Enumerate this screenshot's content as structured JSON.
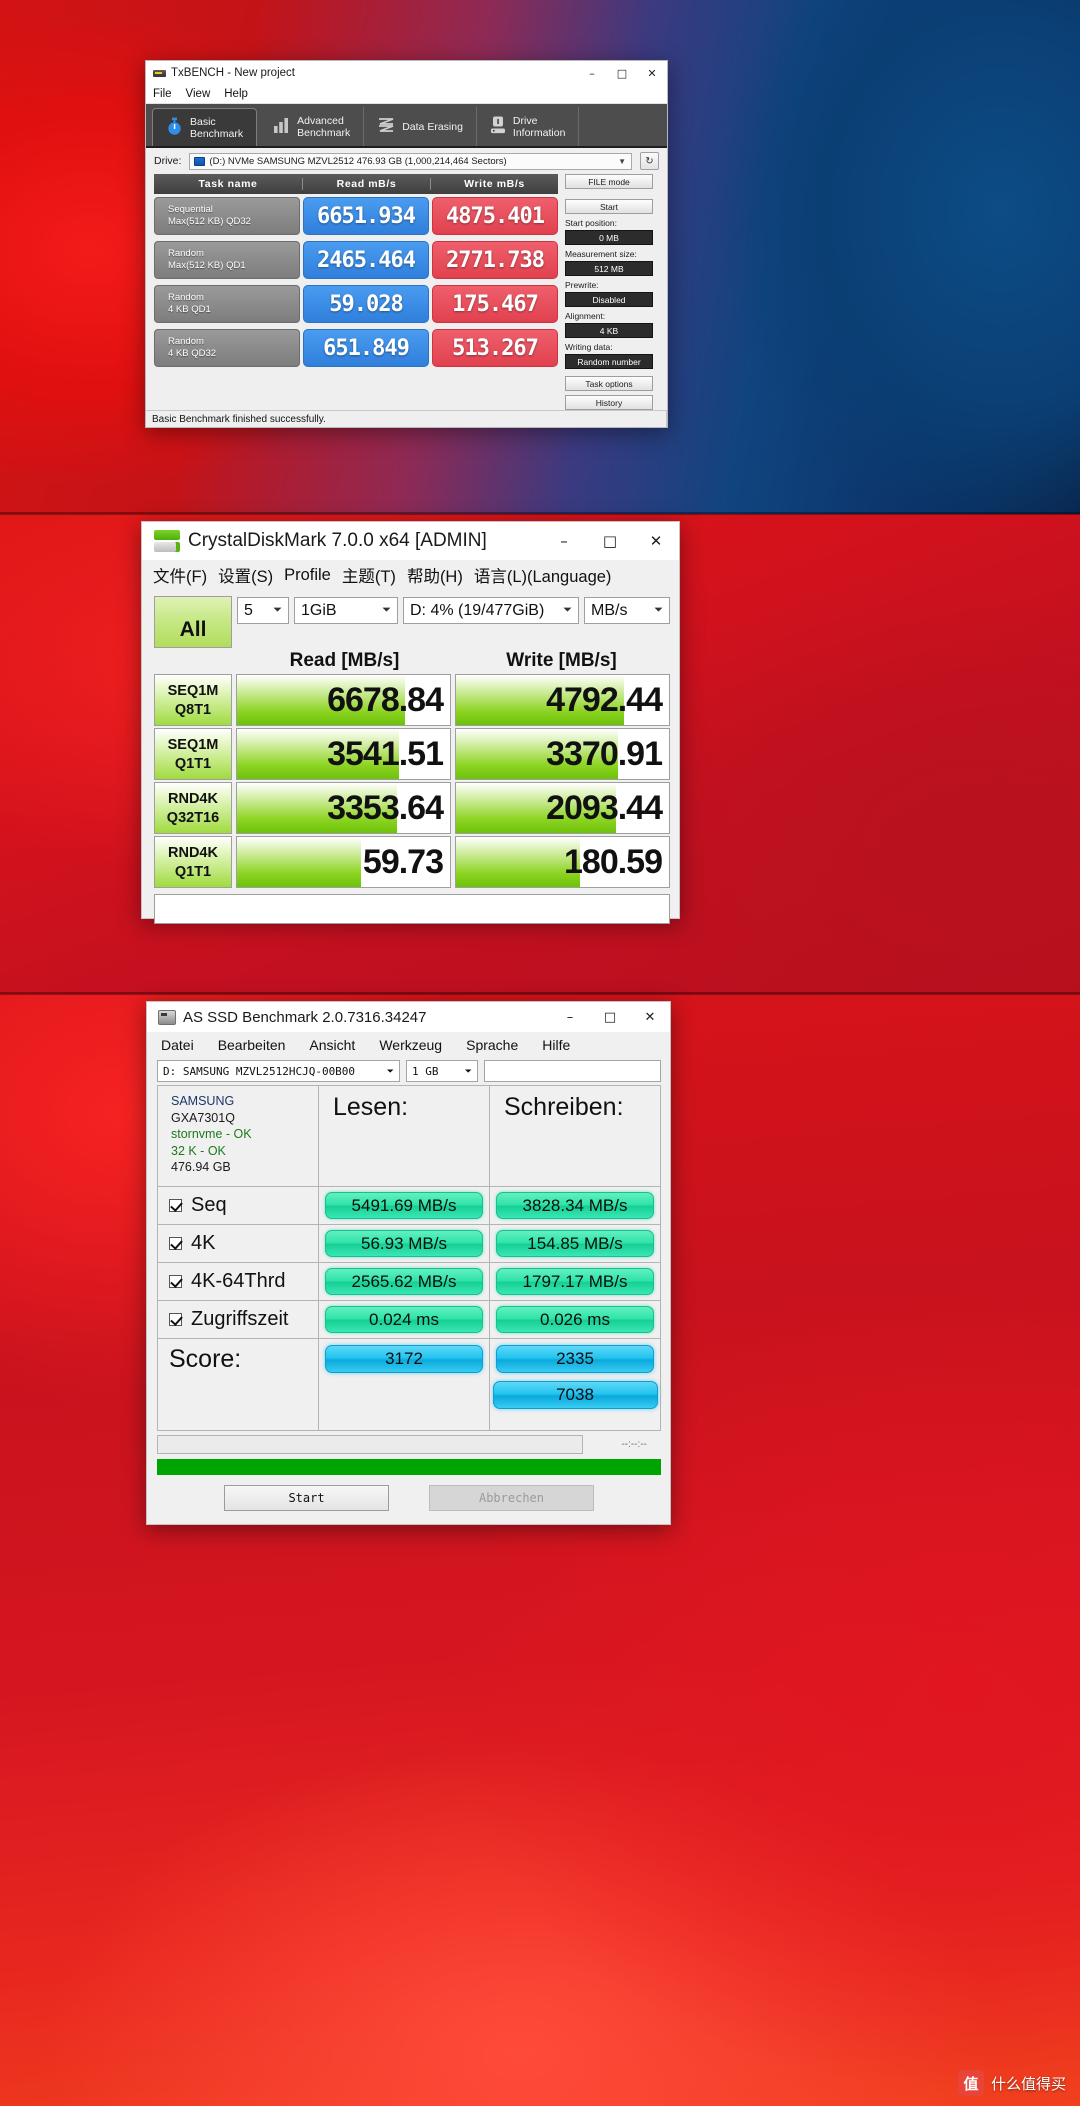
{
  "txbench": {
    "title": "TxBENCH - New project",
    "icon": "app-icon",
    "menu": [
      "File",
      "View",
      "Help"
    ],
    "window_buttons": {
      "minimize": "–",
      "maximize": "□",
      "close": "✕"
    },
    "tabs": [
      {
        "label": "Basic\nBenchmark",
        "icon": "stopwatch-icon",
        "active": true
      },
      {
        "label": "Advanced\nBenchmark",
        "icon": "bar-chart-icon",
        "active": false
      },
      {
        "label": "Data Erasing",
        "icon": "erase-icon",
        "active": false
      },
      {
        "label": "Drive\nInformation",
        "icon": "info-drive-icon",
        "active": false
      }
    ],
    "drive_label": "Drive:",
    "drive_value": "(D:) NVMe SAMSUNG MZVL2512  476.93 GB (1,000,214,464 Sectors)",
    "refresh_icon": "refresh-icon",
    "columns": [
      "Task name",
      "Read mB/s",
      "Write mB/s"
    ],
    "rows": [
      {
        "name": "Sequential\nMax(512 KB) QD32",
        "read": "6651.934",
        "write": "4875.401"
      },
      {
        "name": "Random\nMax(512 KB) QD1",
        "read": "2465.464",
        "write": "2771.738"
      },
      {
        "name": "Random\n4 KB QD1",
        "read": "59.028",
        "write": "175.467"
      },
      {
        "name": "Random\n4 KB QD32",
        "read": "651.849",
        "write": "513.267"
      }
    ],
    "side": {
      "file_mode": "FILE mode",
      "start": "Start",
      "start_position_label": "Start position:",
      "start_position": "0 MB",
      "measurement_label": "Measurement size:",
      "measurement": "512 MB",
      "prewrite_label": "Prewrite:",
      "prewrite": "Disabled",
      "alignment_label": "Alignment:",
      "alignment": "4 KB",
      "writing_label": "Writing data:",
      "writing": "Random number",
      "task_options": "Task options",
      "history": "History"
    },
    "status": "Basic Benchmark finished successfully."
  },
  "crystaldiskmark": {
    "title": "CrystalDiskMark 7.0.0 x64 [ADMIN]",
    "icon": "cdm-icon",
    "menu": [
      "文件(F)",
      "设置(S)",
      "Profile",
      "主题(T)",
      "帮助(H)",
      "语言(L)(Language)"
    ],
    "window_buttons": {
      "minimize": "–",
      "maximize": "□",
      "close": "✕"
    },
    "all_button": "All",
    "runs": "5",
    "size": "1GiB",
    "target": "D: 4% (19/477GiB)",
    "unit": "MB/s",
    "read_header": "Read [MB/s]",
    "write_header": "Write [MB/s]",
    "rows": [
      {
        "label1": "SEQ1M",
        "label2": "Q8T1",
        "read": "6678.84",
        "write": "4792.44",
        "read_pct": 79,
        "write_pct": 79
      },
      {
        "label1": "SEQ1M",
        "label2": "Q1T1",
        "read": "3541.51",
        "write": "3370.91",
        "read_pct": 76,
        "write_pct": 76
      },
      {
        "label1": "RND4K",
        "label2": "Q32T16",
        "read": "3353.64",
        "write": "2093.44",
        "read_pct": 75,
        "write_pct": 75
      },
      {
        "label1": "RND4K",
        "label2": "Q1T1",
        "read": "59.73",
        "write": "180.59",
        "read_pct": 58,
        "write_pct": 58
      }
    ]
  },
  "asssd": {
    "title": "AS SSD Benchmark 2.0.7316.34247",
    "icon": "hdd-icon",
    "menu": [
      "Datei",
      "Bearbeiten",
      "Ansicht",
      "Werkzeug",
      "Sprache",
      "Hilfe"
    ],
    "window_buttons": {
      "minimize": "–",
      "maximize": "□",
      "close": "✕"
    },
    "drive_select": "D:  SAMSUNG MZVL2512HCJQ-00B00",
    "size_select": "1 GB",
    "text_field": "",
    "info": {
      "vendor": "SAMSUNG",
      "firmware": "GXA7301Q",
      "driver": "stornvme - OK",
      "alignment": "32 K - OK",
      "capacity": "476.94 GB"
    },
    "read_header": "Lesen:",
    "write_header": "Schreiben:",
    "score_label": "Score:",
    "rows": [
      {
        "label": "Seq",
        "read": "5491.69 MB/s",
        "write": "3828.34 MB/s",
        "checked": true
      },
      {
        "label": "4K",
        "read": "56.93 MB/s",
        "write": "154.85 MB/s",
        "checked": true
      },
      {
        "label": "4K-64Thrd",
        "read": "2565.62 MB/s",
        "write": "1797.17 MB/s",
        "checked": true
      },
      {
        "label": "Zugriffszeit",
        "read": "0.024 ms",
        "write": "0.026 ms",
        "checked": true
      }
    ],
    "score_read": "3172",
    "score_write": "2335",
    "score_total": "7038",
    "elapsed": "--:--:--",
    "progress_percent": 100,
    "start_button": "Start",
    "cancel_button": "Abbrechen"
  },
  "watermark": {
    "logo": "值",
    "text": "什么值得买"
  },
  "colors": {
    "txbench_read": "#3f8fe8",
    "txbench_write": "#e8505d",
    "cdm_green": "#8ed424",
    "assd_green": "#2fe3a8",
    "assd_blue": "#22c3ef",
    "progress_green": "#00a400"
  }
}
